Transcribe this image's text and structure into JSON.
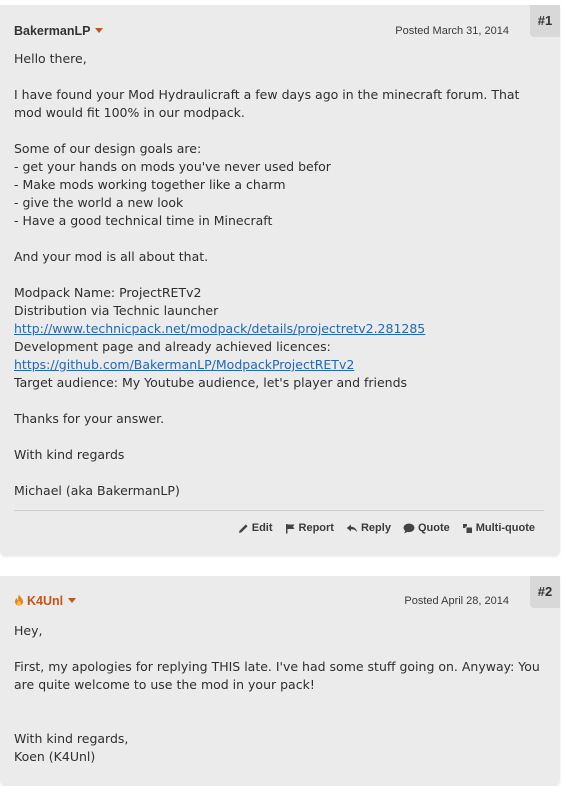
{
  "posts": [
    {
      "author": "BakermanLP",
      "posted": "Posted March 31, 2014",
      "number": "#1",
      "lines": [
        {
          "text": "Hello there,"
        },
        {
          "text": ""
        },
        {
          "text": "I have found your Mod Hydraulicraft a few days ago in the minecraft forum. That"
        },
        {
          "text": "mod would fit 100% in our modpack."
        },
        {
          "text": ""
        },
        {
          "text": "Some of our design goals are:"
        },
        {
          "text": "- get your hands on mods you've never used befor"
        },
        {
          "text": "- Make mods working together like a charm"
        },
        {
          "text": "- give the world a new look"
        },
        {
          "text": "- Have a good technical time in Minecraft"
        },
        {
          "text": ""
        },
        {
          "text": "And your mod is all about that."
        },
        {
          "text": ""
        },
        {
          "text": "Modpack Name: ProjectRETv2"
        },
        {
          "text": "Distribution via Technic launcher"
        },
        {
          "text": "http://www.technicpack.net/modpack/details/projectretv2.281285",
          "link": true
        },
        {
          "text": "Development page and already achieved licences:"
        },
        {
          "text": "https://github.com/BakermanLP/ModpackProjectRETv2",
          "link": true
        },
        {
          "text": "Target audience: My Youtube audience, let's player and friends"
        },
        {
          "text": ""
        },
        {
          "text": "Thanks for your answer."
        },
        {
          "text": ""
        },
        {
          "text": "With kind regards"
        },
        {
          "text": ""
        },
        {
          "text": "Michael (aka BakermanLP)"
        }
      ],
      "actions": {
        "edit": "Edit",
        "report": "Report",
        "reply": "Reply",
        "quote": "Quote",
        "multiquote": "Multi-quote"
      }
    },
    {
      "author": "K4Unl",
      "posted": "Posted April 28, 2014",
      "number": "#2",
      "lines": [
        {
          "text": "Hey,"
        },
        {
          "text": ""
        },
        {
          "text": "First, my apologies for replying THIS late. I've had some stuff going on. Anyway: You"
        },
        {
          "text": "are quite welcome to use the mod in your pack!"
        },
        {
          "text": ""
        },
        {
          "text": ""
        },
        {
          "text": "With kind regards,"
        },
        {
          "text": "Koen (K4Unl)"
        }
      ]
    }
  ],
  "colors": {
    "post_background": "#ebebeb",
    "link": "#2468b2",
    "staff_name": "#c1561a",
    "caret": "#c1561a",
    "post_number_background": "#d8d8d8"
  },
  "icons": [
    "pencil-icon",
    "flag-icon",
    "reply-arrow-icon",
    "speech-bubble-icon",
    "multi-quote-icon",
    "flame-icon",
    "chevron-down-icon"
  ]
}
